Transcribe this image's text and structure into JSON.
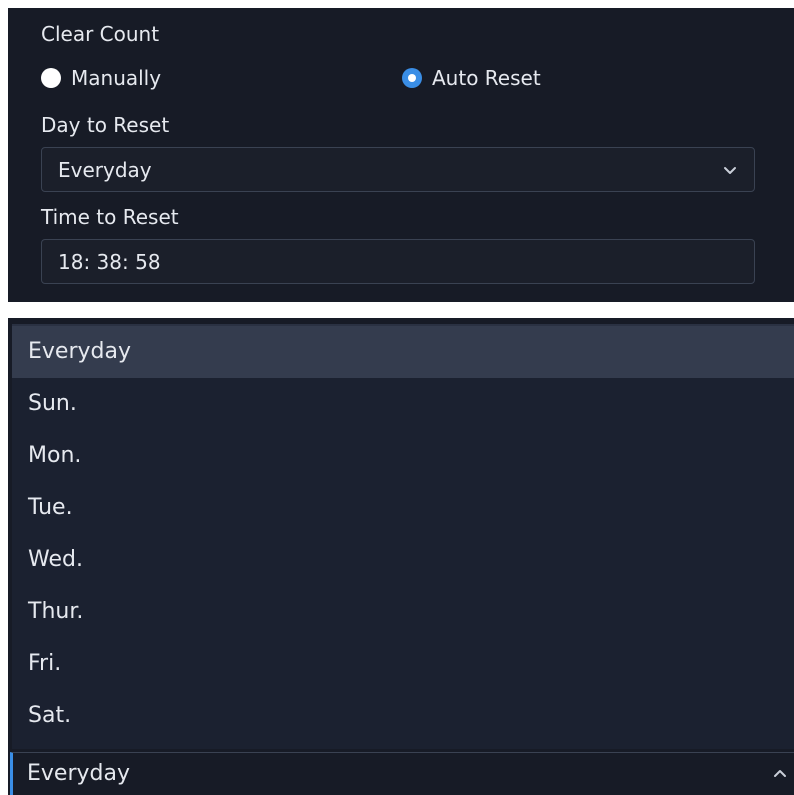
{
  "settings": {
    "clear_count_label": "Clear Count",
    "reset_mode": {
      "options": [
        {
          "label": "Manually",
          "selected": false
        },
        {
          "label": "Auto Reset",
          "selected": true
        }
      ]
    },
    "day_to_reset": {
      "label": "Day to Reset",
      "value": "Everyday",
      "icon": "chevron-down-icon"
    },
    "time_to_reset": {
      "label": "Time to Reset",
      "value": "18: 38: 58"
    }
  },
  "dropdown": {
    "options": [
      "Everyday",
      "Sun.",
      "Mon.",
      "Tue.",
      "Wed.",
      "Thur.",
      "Fri.",
      "Sat."
    ],
    "highlighted": "Everyday",
    "current_value": "Everyday",
    "icon": "chevron-up-icon"
  },
  "colors": {
    "panel_bg": "#171b26",
    "accent": "#3a8ee6",
    "text": "#e6e9ef",
    "highlight_row": "#343c4e"
  }
}
